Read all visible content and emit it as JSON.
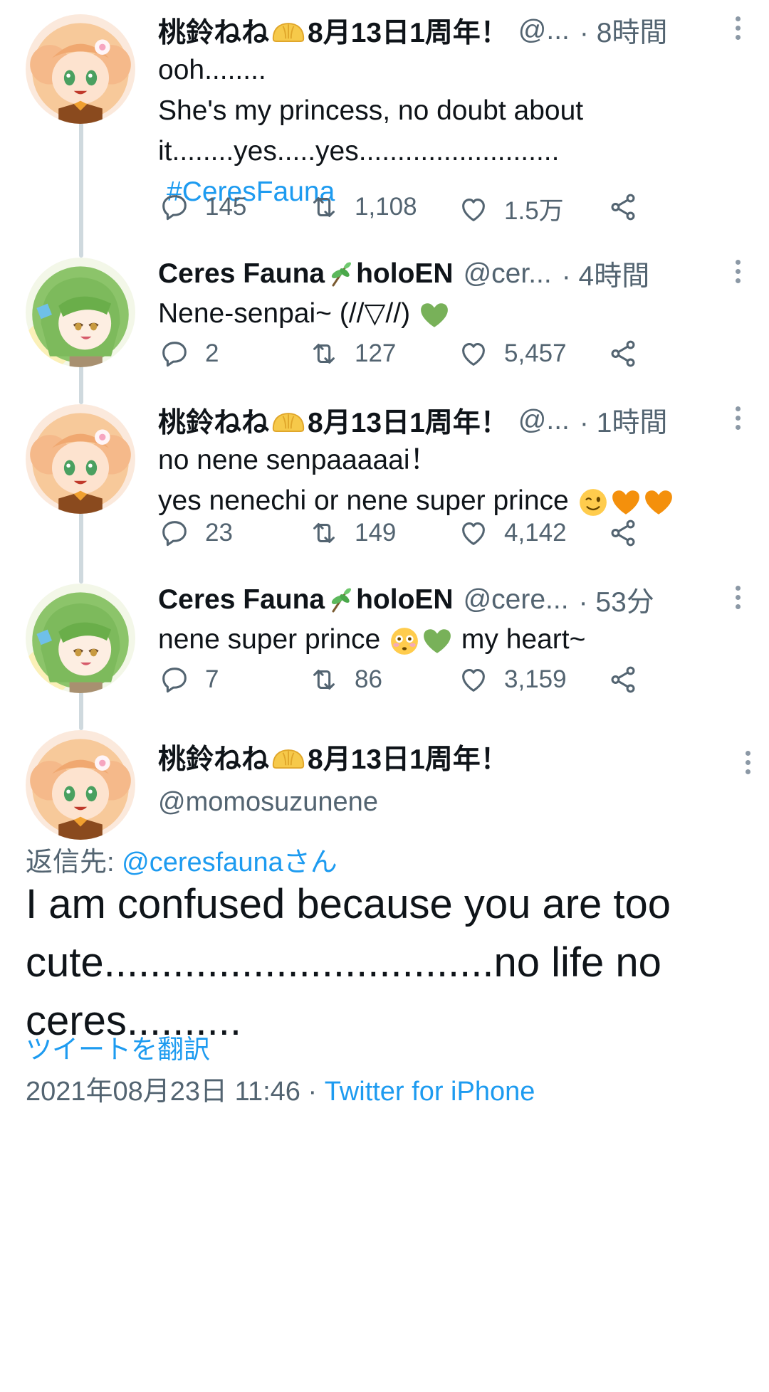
{
  "thread": [
    {
      "author": "桃鈴ねね",
      "badge": "8月13日1周年！",
      "handle": "@...",
      "time": "· 8時間",
      "lines": [
        "ooh........",
        "She's my princess, no doubt about",
        "it........yes.....yes.........................."
      ],
      "hashtag": "#CeresFauna",
      "replies": "145",
      "retweets": "1,108",
      "likes": "1.5万",
      "avatar": "nene",
      "colors": {
        "accent": "#1d9bf0"
      }
    },
    {
      "author": "Ceres Fauna",
      "badge": "holoEN",
      "handle": "@cer...",
      "time": "· 4時間",
      "lines": [
        "Nene-senpai~ (//▽//)"
      ],
      "replies": "2",
      "retweets": "127",
      "likes": "5,457",
      "avatar": "fauna"
    },
    {
      "author": "桃鈴ねね",
      "badge": "8月13日1周年！",
      "handle": "@...",
      "time": "· 1時間",
      "lines": [
        "no nene senpaaaaai！",
        "yes nenechi or nene super prince"
      ],
      "replies": "23",
      "retweets": "149",
      "likes": "4,142",
      "avatar": "nene"
    },
    {
      "author": "Ceres Fauna",
      "badge": "holoEN",
      "handle": "@cere...",
      "time": "· 53分",
      "line_a": "nene super prince",
      "line_b": "my heart~",
      "replies": "7",
      "retweets": "86",
      "likes": "3,159",
      "avatar": "fauna"
    }
  ],
  "main": {
    "author": "桃鈴ねね",
    "badge": "8月13日1周年！",
    "handle": "@momosuzunene",
    "reply_prefix": "返信先:",
    "reply_mention": "@ceresfaunaさん",
    "text": "I am confused because you are too cute..................................no life no ceres..........",
    "translate": "ツイートを翻訳",
    "datetime": "2021年08月23日 11:46 ·",
    "source": "Twitter for iPhone"
  },
  "icons": [
    "reply-icon",
    "retweet-icon",
    "like-icon",
    "share-icon",
    "more-icon",
    "nikuman-emoji",
    "sprout-emoji",
    "green-heart-emoji",
    "orange-heart-emoji",
    "wink-emoji",
    "flushed-emoji"
  ],
  "colors": {
    "link": "#1d9bf0",
    "muted": "#536471",
    "thread_line": "#cfd9de",
    "text": "#0f1419"
  }
}
